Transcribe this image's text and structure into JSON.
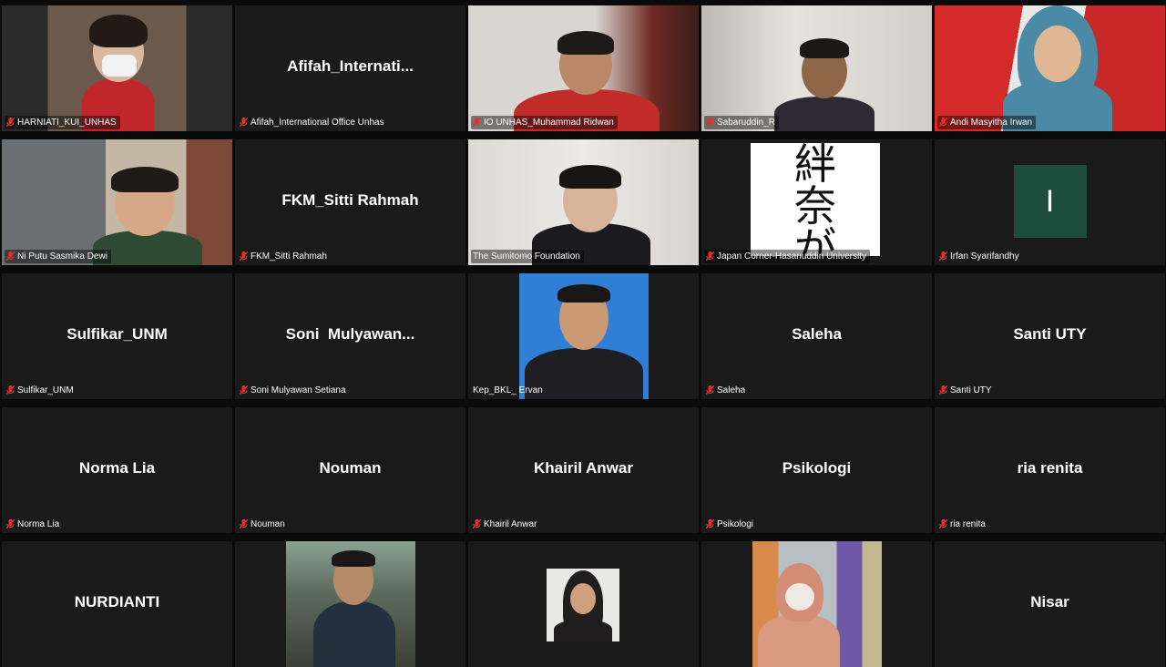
{
  "tiles": [
    {
      "name": "HARNIATI_KUI_UNHAS",
      "video": true
    },
    {
      "name": "Afifah_International Office Unhas",
      "display": "Afifah_Internati..."
    },
    {
      "name": "IO UNHAS_Muhammad Ridwan",
      "video": true
    },
    {
      "name": "Sabaruddin_R",
      "video": true
    },
    {
      "name": "Andi Masyitha Irwan",
      "video": true
    },
    {
      "name": "Ni Putu Sasmika Dewi",
      "video": true
    },
    {
      "name": "FKM_Sitti Rahmah",
      "display": "FKM_Sitti Rahmah"
    },
    {
      "name": "The Sumitomo Foundation",
      "video": true,
      "speaking": true
    },
    {
      "name": "Japan Corner-Hasanuddin University",
      "video": true
    },
    {
      "name": "Irfan Syarifandhy",
      "avatar_letter": "I"
    },
    {
      "name": "Sulfikar_UNM",
      "display": "Sulfikar_UNM"
    },
    {
      "name": "Soni Mulyawan Setiana",
      "display": "Soni  Mulyawan..."
    },
    {
      "name": "Kep_BKL_ Ervan",
      "video": true,
      "mic_hidden": true
    },
    {
      "name": "Saleha",
      "display": "Saleha"
    },
    {
      "name": "Santi UTY",
      "display": "Santi UTY"
    },
    {
      "name": "Norma Lia",
      "display": "Norma Lia"
    },
    {
      "name": "Nouman",
      "display": "Nouman"
    },
    {
      "name": "Khairil Anwar",
      "display": "Khairil Anwar"
    },
    {
      "name": "Psikologi",
      "display": "Psikologi"
    },
    {
      "name": "ria renita",
      "display": "ria renita"
    },
    {
      "name": "NURDIANTI",
      "display": "NURDIANTI",
      "label_hidden": true
    },
    {
      "name": "",
      "video": true,
      "label_hidden": true
    },
    {
      "name": "",
      "video": true,
      "label_hidden": true
    },
    {
      "name": "",
      "video": true,
      "label_hidden": true
    },
    {
      "name": "Nisar",
      "display": "Nisar",
      "label_hidden": true
    }
  ],
  "avatar_letter": "I",
  "calligraphy_text": "絆\n奈\nが",
  "colors": {
    "mic_muted": "#e0322b",
    "speaker_outline": "#c9df5a",
    "tile_bg": "#1a1a1a"
  },
  "icons": {
    "muted": "mic-muted-icon"
  }
}
